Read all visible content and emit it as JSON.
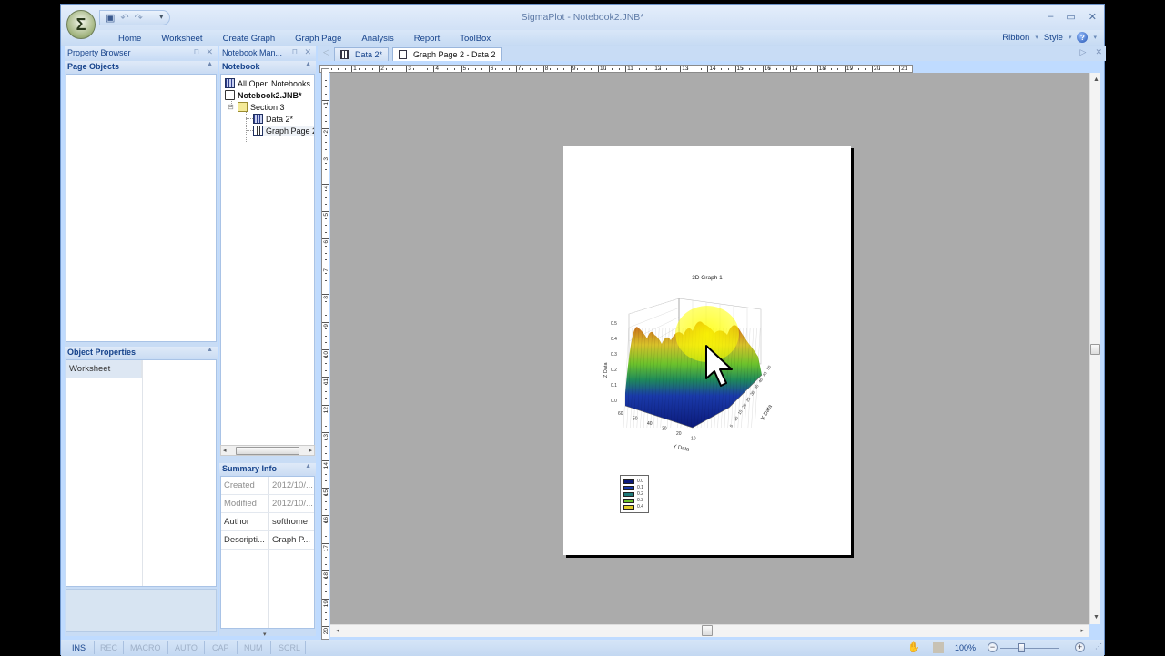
{
  "window": {
    "title": "SigmaPlot - Notebook2.JNB*",
    "app_button_glyph": "Σ",
    "quick_access": [
      "save-icon",
      "undo-icon",
      "redo-icon"
    ],
    "controls": [
      "minimize-icon",
      "maximize-icon",
      "close-icon"
    ]
  },
  "ribbon": {
    "tabs": [
      "Home",
      "Worksheet",
      "Create Graph",
      "Graph Page",
      "Analysis",
      "Report",
      "ToolBox"
    ],
    "right_menu": {
      "ribbon_label": "Ribbon",
      "style_label": "Style",
      "help_glyph": "?"
    }
  },
  "property_browser": {
    "title": "Property Browser",
    "page_objects_label": "Page Objects",
    "object_properties_label": "Object Properties",
    "rows": [
      {
        "key": "Worksheet",
        "value": ""
      }
    ]
  },
  "notebook_manager": {
    "title": "Notebook Man...",
    "section_label": "Notebook",
    "tree": [
      {
        "label": "All Open Notebooks",
        "icon": "notebooks-grid-icon",
        "level": 0
      },
      {
        "label": "Notebook2.JNB*",
        "icon": "notebook-icon",
        "level": 0,
        "bold": true
      },
      {
        "label": "Section 3",
        "icon": "section-folder-icon",
        "level": 1
      },
      {
        "label": "Data 2*",
        "icon": "worksheet-icon",
        "level": 2
      },
      {
        "label": "Graph Page 2",
        "icon": "graph-page-icon",
        "level": 2,
        "selected": true
      }
    ],
    "summary_label": "Summary Info",
    "summary": [
      {
        "key": "Created",
        "value": "2012/10/...",
        "muted": true
      },
      {
        "key": "Modified",
        "value": "2012/10/...",
        "muted": true
      },
      {
        "key": "Author",
        "value": "softhome",
        "muted": false
      },
      {
        "key": "Descripti...",
        "value": "Graph P...",
        "muted": false
      }
    ]
  },
  "doc_tabs": [
    {
      "label": "Data 2*",
      "icon": "worksheet-icon",
      "active": false
    },
    {
      "label": "Graph Page 2 - Data 2",
      "icon": "graph-page-icon",
      "active": true
    }
  ],
  "rulers": {
    "horizontal": [
      "1",
      "2",
      "3",
      "4",
      "5",
      "6",
      "7",
      "8",
      "9",
      "10",
      "11",
      "12",
      "13",
      "14",
      "15",
      "16",
      "17",
      "18",
      "19",
      "20",
      "21"
    ],
    "vertical": [
      "1",
      "2",
      "3",
      "4",
      "5",
      "6",
      "7",
      "8",
      "9",
      "10",
      "11",
      "12",
      "13",
      "14",
      "15",
      "16",
      "17",
      "18",
      "19",
      "20"
    ]
  },
  "graph": {
    "title": "3D Graph 1",
    "type": "3D mesh surface",
    "z_axis_label": "Z Data",
    "y_axis_label": "Y Data",
    "x_axis_label": "X Data",
    "z_ticks": [
      "0.0",
      "0.1",
      "0.2",
      "0.3",
      "0.4",
      "0.5"
    ],
    "y_ticks": [
      "60",
      "50",
      "40",
      "30",
      "20",
      "10"
    ],
    "x_ticks": [
      "5",
      "10",
      "15",
      "20",
      "25",
      "30",
      "35",
      "40",
      "45",
      "50"
    ],
    "legend": [
      {
        "label": "0.0",
        "color": "#0b1a7a"
      },
      {
        "label": "0.1",
        "color": "#1a3aaa"
      },
      {
        "label": "0.2",
        "color": "#1f7a7a"
      },
      {
        "label": "0.3",
        "color": "#6cc22c"
      },
      {
        "label": "0.4",
        "color": "#e2cc2a"
      }
    ]
  },
  "status_bar": {
    "indicators": [
      {
        "label": "INS",
        "active": true
      },
      {
        "label": "REC",
        "active": false
      },
      {
        "label": "MACRO",
        "active": false
      },
      {
        "label": "AUTO",
        "active": false
      },
      {
        "label": "CAP",
        "active": false
      },
      {
        "label": "NUM",
        "active": false
      },
      {
        "label": "SCRL",
        "active": false
      }
    ],
    "zoom": "100%",
    "zoom_minus": "−",
    "zoom_plus": "+"
  }
}
